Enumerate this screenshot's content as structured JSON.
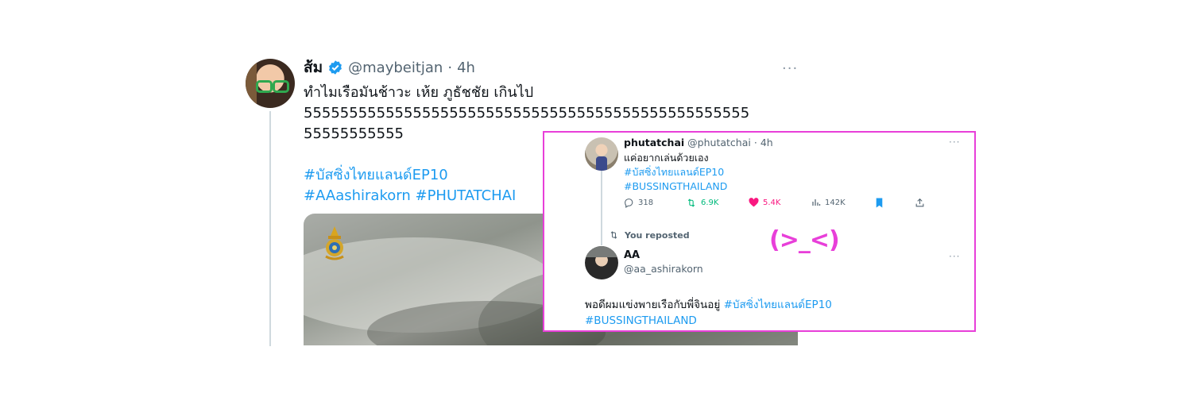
{
  "main_tweet": {
    "display_name": "ส้ม",
    "handle": "@maybeitjan",
    "separator": "·",
    "time": "4h",
    "more": "···",
    "text_line1": "ทำไมเรือมันช้าวะ เห้ย ภูธัชชัย เกินไป",
    "text_line2": "5555555555555555555555555555555555555555555555555",
    "text_line3": "55555555555",
    "hashtag1": "#บัสซิ่งไทยแลนด์EP10",
    "hashtag2": "#AAashirakorn",
    "hashtag3": "#PHUTATCHAI"
  },
  "quoted": {
    "tweet1": {
      "display_name": "phutatchai",
      "handle": "@phutatchai",
      "separator": "·",
      "time": "4h",
      "more": "···",
      "text": "แค่อยากเล่นด้วยเอง",
      "hashtag1": "#บัสซิ่งไทยแลนด์EP10",
      "hashtag2": "#BUSSINGTHAILAND",
      "replies": "318",
      "retweets": "6.9K",
      "likes": "5.4K",
      "views": "142K"
    },
    "repost_label": "You reposted",
    "tweet2": {
      "display_name": "AA",
      "handle": "@aa_ashirakorn",
      "more": "···",
      "text": "พอดีผมแข่งพายเรือกับพี่จินอยู่",
      "hashtag1": "#บัสซิ่งไทยแลนด์EP10",
      "hashtag2": "#BUSSINGTHAILAND"
    }
  },
  "annotation": {
    "emoticon": "(>_<)"
  },
  "colors": {
    "link": "#1d9bf0",
    "highlight_border": "#e83fd9",
    "retweet": "#00ba7c",
    "like": "#f91880"
  },
  "icons": [
    "verified-badge-icon",
    "reply-icon",
    "retweet-icon",
    "like-icon",
    "views-icon",
    "bookmark-icon",
    "share-icon",
    "repost-icon"
  ]
}
